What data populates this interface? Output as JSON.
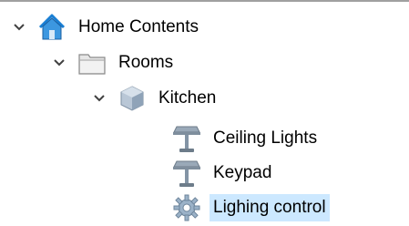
{
  "tree": {
    "root": {
      "label": "Home Contents",
      "icon": "home-icon",
      "expanded": true
    },
    "rooms": {
      "label": "Rooms",
      "icon": "folder-icon",
      "expanded": true
    },
    "kitchen": {
      "label": "Kitchen",
      "icon": "room-cube-icon",
      "expanded": true
    },
    "children": [
      {
        "label": "Ceiling Lights",
        "icon": "lamp-icon"
      },
      {
        "label": "Keypad",
        "icon": "lamp-icon"
      },
      {
        "label": "Lighing control",
        "icon": "gear-icon",
        "selected": true
      }
    ]
  },
  "colors": {
    "selection": "#cce8ff",
    "home_roof": "#1a7fd4",
    "folder": "#d9d9d9",
    "gear": "#9bb2c8"
  }
}
